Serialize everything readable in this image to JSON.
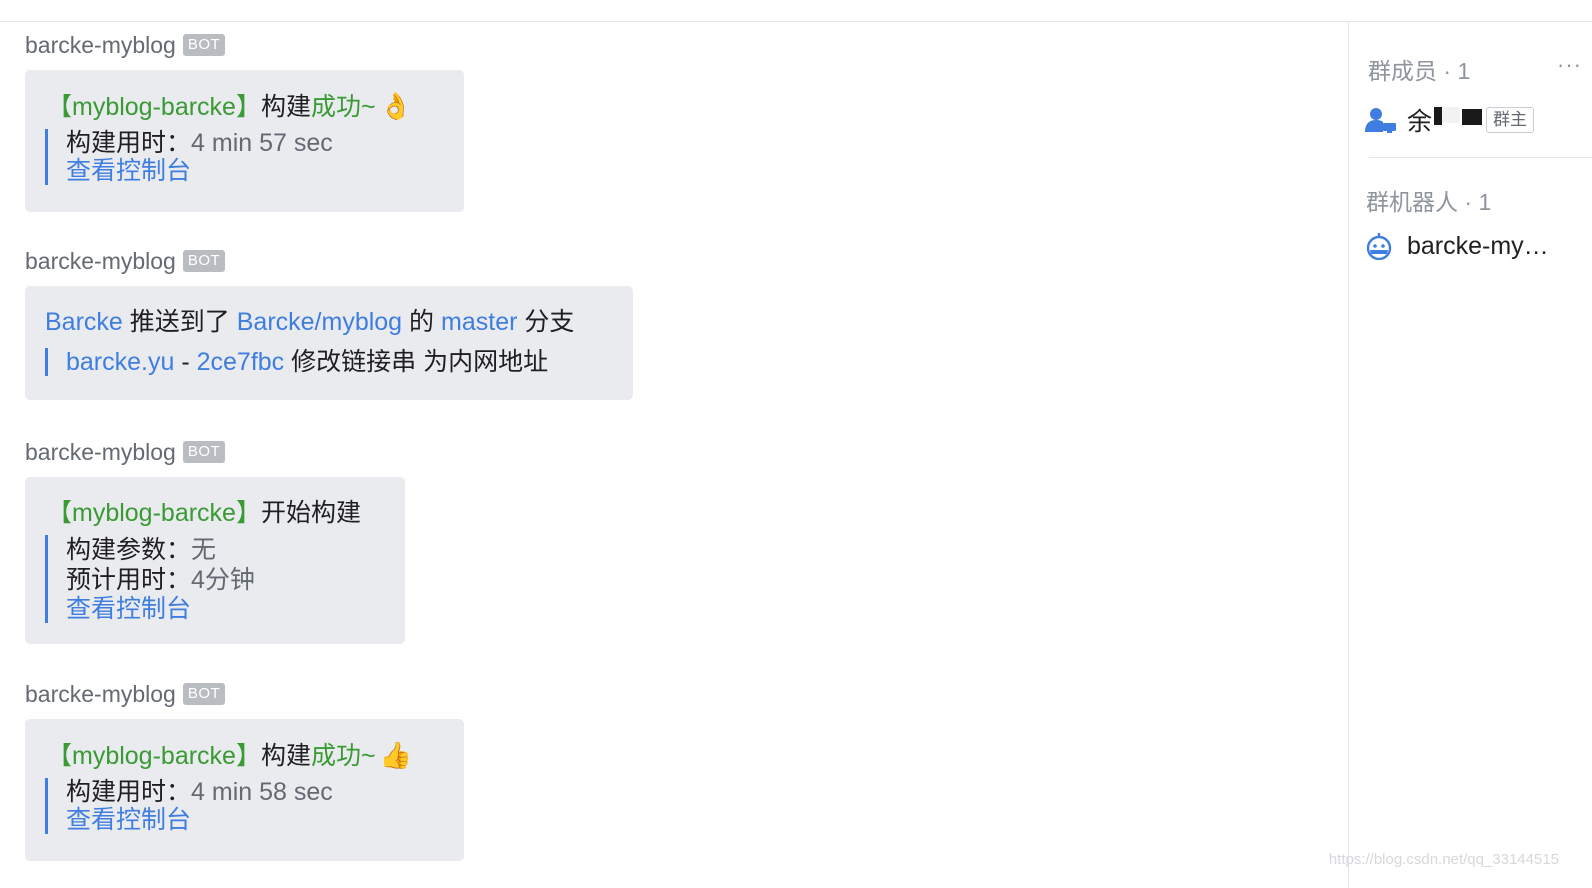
{
  "messages": [
    {
      "sender": "barcke-myblog",
      "badge": "BOT",
      "title_project": "【myblog-barcke】",
      "title_action": "构建",
      "title_status": "成功",
      "title_tilde": "~",
      "emoji": "👌",
      "line1_label": "构建用时：",
      "line1_value": "4 min 57 sec",
      "link": "查看控制台"
    },
    {
      "sender": "barcke-myblog",
      "badge": "BOT",
      "user": "Barcke",
      "pushed": "推送到了",
      "repo": "Barcke/myblog",
      "of": "的",
      "branch": "master",
      "branch_word": "分支",
      "author": "barcke.yu",
      "dash": "-",
      "commit": "2ce7fbc",
      "commit_msg": "修改链接串 为内网地址"
    },
    {
      "sender": "barcke-myblog",
      "badge": "BOT",
      "title_project": "【myblog-barcke】",
      "title_action": "开始构建",
      "line1_label": "构建参数：",
      "line1_value": "无",
      "line2_label": "预计用时：",
      "line2_value": "4分钟",
      "link": "查看控制台"
    },
    {
      "sender": "barcke-myblog",
      "badge": "BOT",
      "title_project": "【myblog-barcke】",
      "title_action": "构建",
      "title_status": "成功",
      "title_tilde": "~",
      "emoji": "👍",
      "line1_label": "构建用时：",
      "line1_value": "4 min 58 sec",
      "link": "查看控制台"
    }
  ],
  "panel": {
    "members_title": "群成员 · 1",
    "more": "···",
    "member_name": "余",
    "owner_tag": "群主",
    "bots_title": "群机器人 · 1",
    "bot_name": "barcke-my…"
  },
  "watermark": "https://blog.csdn.net/qq_33144515",
  "colors": {
    "accent_blue": "#3f7ee0",
    "success_green": "#3a9a34",
    "bubble_bg": "#e9ebef"
  }
}
